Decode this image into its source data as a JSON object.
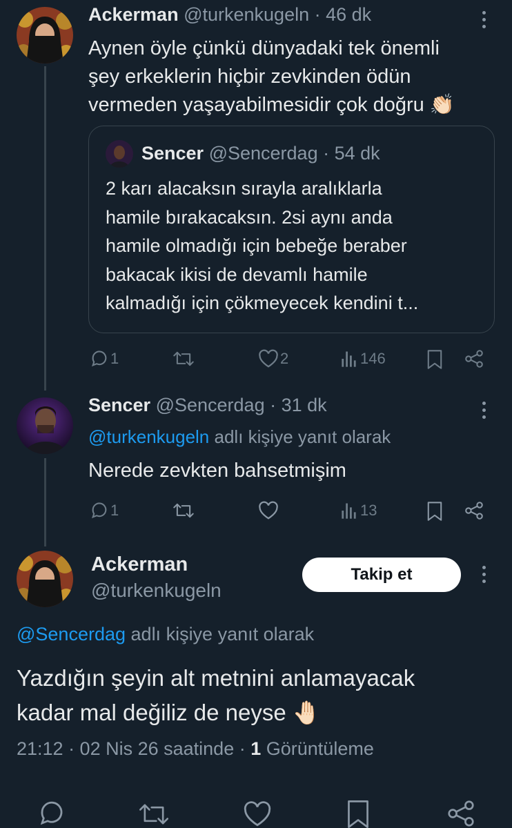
{
  "tweet1": {
    "name": "Ackerman",
    "handle": "@turkenkugeln",
    "time": "· 46 dk",
    "text_lines": [
      "Aynen öyle çünkü dünyadaki tek önemli",
      "şey erkeklerin hiçbir zevkinden ödün",
      "vermeden yaşayabilmesidir çok doğru 👏🏻"
    ],
    "quote": {
      "name": "Sencer",
      "handle": "@Sencerdag",
      "time": "· 54 dk",
      "lines": [
        "2 karı alacaksın sırayla aralıklarla",
        "hamile bırakacaksın. 2si aynı anda",
        "hamile olmadığı için bebeğe beraber",
        "bakacak ikisi de devamlı hamile",
        "kalmadığı için çökmeyecek kendini t..."
      ]
    },
    "stats": {
      "replies": "1",
      "likes": "2",
      "views": "146"
    }
  },
  "tweet2": {
    "name": "Sencer",
    "handle": "@Sencerdag",
    "time": "· 31 dk",
    "reply_to_handle": "@turkenkugeln",
    "reply_to_suffix": "adlı kişiye yanıt olarak",
    "text": "Nerede zevkten bahsetmişim",
    "stats": {
      "replies": "1",
      "views": "13"
    }
  },
  "main_tweet": {
    "name": "Ackerman",
    "handle": "@turkenkugeln",
    "follow_label": "Takip et",
    "reply_to_handle": "@Sencerdag",
    "reply_to_suffix": "adlı kişiye yanıt olarak",
    "text_lines": [
      "Yazdığın şeyin alt metnini anlamayacak",
      "kadar mal değiliz de neyse 🤚🏻"
    ],
    "meta_time": "21:12 · 02 Nis 26 saatinde ·",
    "meta_views_count": "1",
    "meta_views_label": "Görüntüleme"
  },
  "icons": [
    "reply-icon",
    "retweet-icon",
    "like-icon",
    "views-icon",
    "bookmark-icon",
    "share-icon",
    "more-icon"
  ],
  "colors": {
    "background": "#15202b",
    "link": "#1d9bf0",
    "muted": "#8b98a5",
    "border": "#38444d"
  }
}
